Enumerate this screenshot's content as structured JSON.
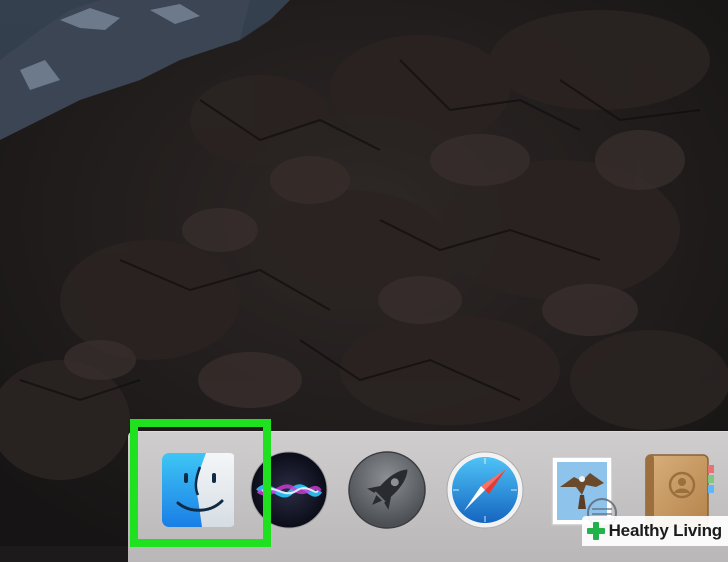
{
  "watermark": {
    "text": "Healthy Living",
    "brand_color": "#21b24b"
  },
  "highlight": {
    "color": "#1fe11f",
    "target": "finder"
  },
  "dock": {
    "items": [
      {
        "name": "finder",
        "icon": "finder-icon"
      },
      {
        "name": "siri",
        "icon": "siri-icon"
      },
      {
        "name": "launchpad",
        "icon": "rocket-icon"
      },
      {
        "name": "safari",
        "icon": "compass-icon"
      },
      {
        "name": "mail",
        "icon": "eagle-stamp-icon"
      },
      {
        "name": "contacts",
        "icon": "address-book-icon"
      }
    ]
  }
}
